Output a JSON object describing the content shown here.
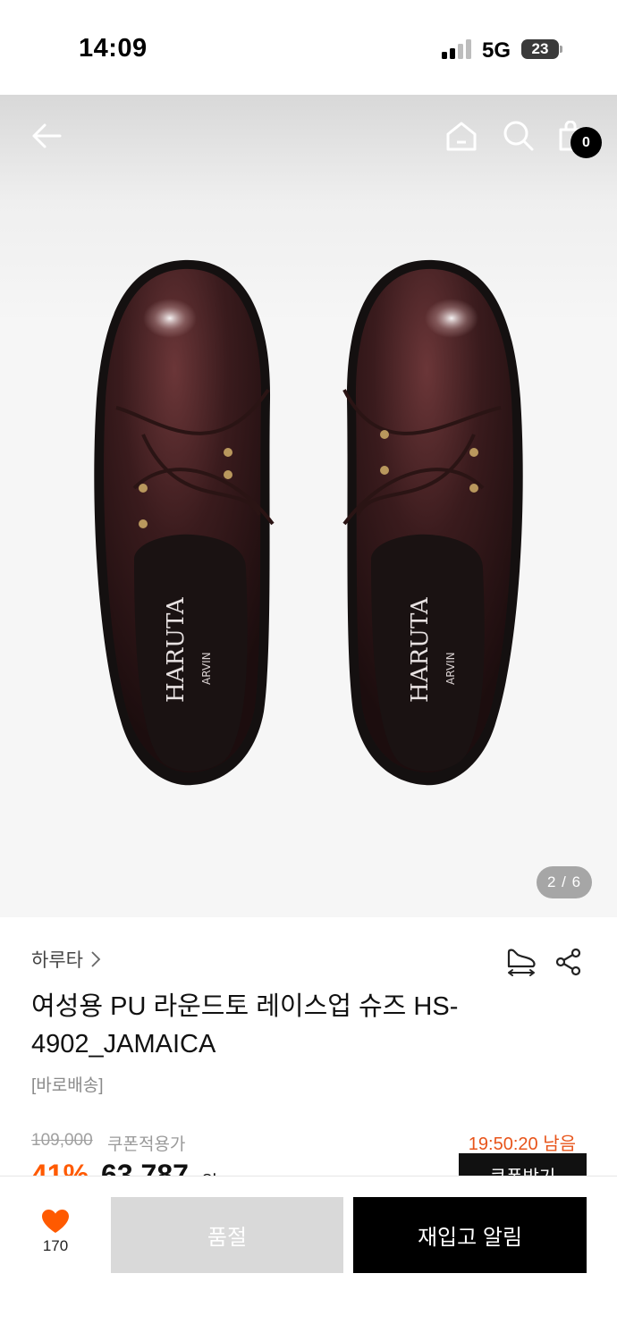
{
  "status_bar": {
    "time": "14:09",
    "network": "5G",
    "battery": "23"
  },
  "header": {
    "cart_count": "0"
  },
  "gallery": {
    "pager": "2 / 6"
  },
  "product": {
    "brand": "하루타",
    "title": "여성용 PU 라운드토 레이스업 슈즈 HS-4902_JAMAICA",
    "delivery": "[바로배송]",
    "original_price": "109,000",
    "coupon_price_label": "쿠폰적용가",
    "timer": "19:50:20 남음",
    "discount": "41%",
    "sale_price": "63,787",
    "currency": "원",
    "coupon_button": "쿠폰받기"
  },
  "bottom_bar": {
    "like_count": "170",
    "soldout_label": "품절",
    "restock_label": "재입고 알림"
  },
  "colors": {
    "accent": "#ff5a00",
    "timer": "#e8541a",
    "primary": "#000000",
    "disabled": "#d9d9d9"
  }
}
